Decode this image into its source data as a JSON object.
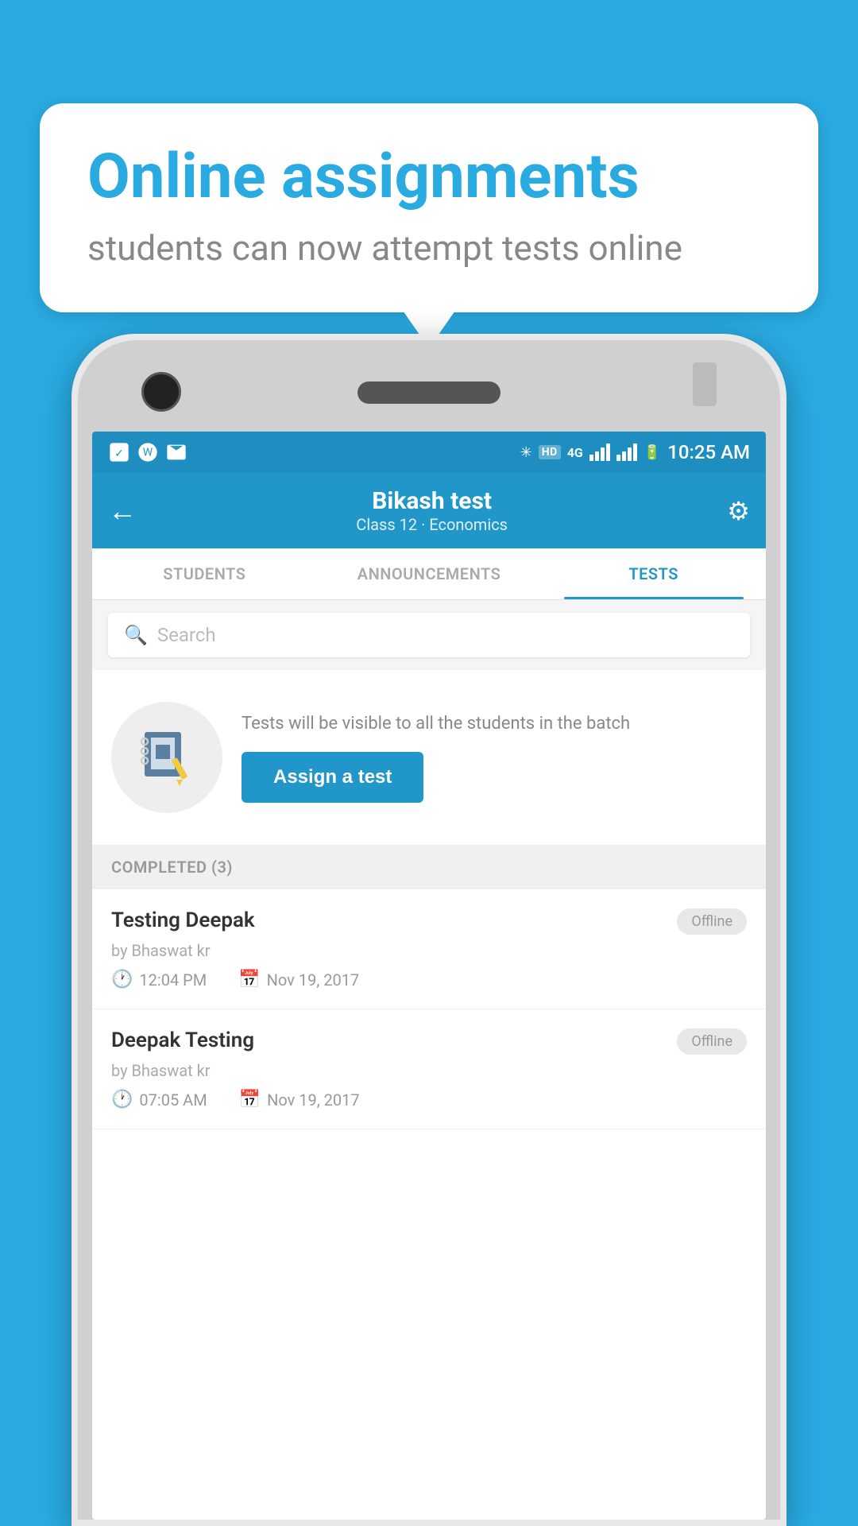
{
  "background_color": "#29aae1",
  "bubble": {
    "title": "Online assignments",
    "subtitle": "students can now attempt tests online"
  },
  "status_bar": {
    "time": "10:25 AM",
    "hd_label": "HD",
    "network_label": "4G"
  },
  "header": {
    "title": "Bikash test",
    "subtitle": "Class 12 · Economics",
    "back_icon": "←",
    "gear_icon": "⚙"
  },
  "tabs": [
    {
      "label": "STUDENTS",
      "active": false
    },
    {
      "label": "ANNOUNCEMENTS",
      "active": false
    },
    {
      "label": "TESTS",
      "active": true
    }
  ],
  "search": {
    "placeholder": "Search"
  },
  "info": {
    "description": "Tests will be visible to all the students in the batch",
    "assign_button": "Assign a test"
  },
  "completed_section": {
    "label": "COMPLETED (3)"
  },
  "tests": [
    {
      "name": "Testing Deepak",
      "author": "by Bhaswat kr",
      "time": "12:04 PM",
      "date": "Nov 19, 2017",
      "status": "Offline"
    },
    {
      "name": "Deepak Testing",
      "author": "by Bhaswat kr",
      "time": "07:05 AM",
      "date": "Nov 19, 2017",
      "status": "Offline"
    }
  ]
}
